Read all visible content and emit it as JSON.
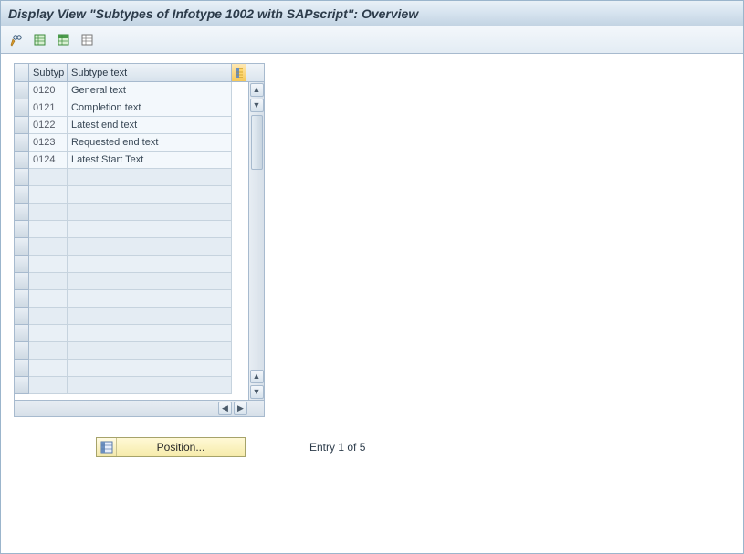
{
  "title": "Display View \"Subtypes of Infotype 1002 with SAPscript\": Overview",
  "toolbar": {
    "btn1": "change-mode",
    "btn2": "select-all",
    "btn3": "deselect-all",
    "btn4": "print"
  },
  "table": {
    "columns": {
      "subtyp": "Subtyp",
      "subtext": "Subtype text"
    },
    "rows": [
      {
        "sub": "0120",
        "text": "General text"
      },
      {
        "sub": "0121",
        "text": "Completion text"
      },
      {
        "sub": "0122",
        "text": "Latest end text"
      },
      {
        "sub": "0123",
        "text": "Requested end text"
      },
      {
        "sub": "0124",
        "text": "Latest Start Text"
      }
    ]
  },
  "footer": {
    "position_label": "Position...",
    "entry_text": "Entry 1 of 5"
  }
}
